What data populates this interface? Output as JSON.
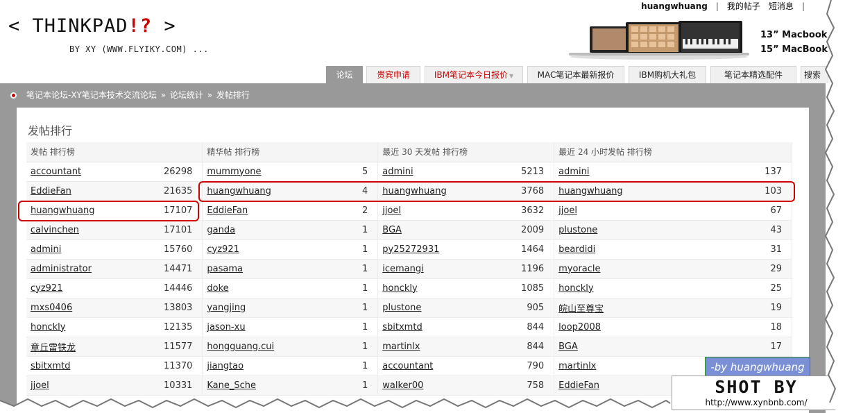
{
  "header": {
    "logo_line1": "< THINKPAD",
    "logo_bang": "!?",
    "logo_close": " >",
    "logo_line2": "BY XY (WWW.FLYIKY.COM) ..."
  },
  "toplinks": {
    "user": "huangwhuang",
    "my_posts": "我的帖子",
    "messages": "短消息"
  },
  "promo": {
    "line1": "13” Macbook",
    "line2": "15” MacBook"
  },
  "nav": {
    "tabs": [
      {
        "label": "论坛"
      },
      {
        "label": "贵宾申请"
      },
      {
        "label": "IBM笔记本今日报价"
      },
      {
        "label": "MAC笔记本最新报价"
      },
      {
        "label": "IBM购机大礼包"
      },
      {
        "label": "笔记本精选配件"
      },
      {
        "label": "搜索"
      }
    ]
  },
  "breadcrumb": {
    "items": [
      "笔记本论坛-XY笔记本技术交流论坛",
      "»",
      "论坛统计",
      "»",
      "发帖排行"
    ]
  },
  "page_title": "发帖排行",
  "columns": [
    "发帖 排行榜",
    "精华帖 排行榜",
    "最近 30 天发帖 排行榜",
    "最近 24 小时发帖 排行榜"
  ],
  "rows": [
    [
      [
        "accountant",
        "26298"
      ],
      [
        "mummyone",
        "5"
      ],
      [
        "admini",
        "5213"
      ],
      [
        "admini",
        "137"
      ]
    ],
    [
      [
        "EddieFan",
        "21635"
      ],
      [
        "huangwhuang",
        "4"
      ],
      [
        "huangwhuang",
        "3768"
      ],
      [
        "huangwhuang",
        "103"
      ]
    ],
    [
      [
        "huangwhuang",
        "17107"
      ],
      [
        "EddieFan",
        "2"
      ],
      [
        "jjoel",
        "3632"
      ],
      [
        "jjoel",
        "67"
      ]
    ],
    [
      [
        "calvinchen",
        "17101"
      ],
      [
        "ganda",
        "1"
      ],
      [
        "BGA",
        "2009"
      ],
      [
        "plustone",
        "43"
      ]
    ],
    [
      [
        "admini",
        "15760"
      ],
      [
        "cyz921",
        "1"
      ],
      [
        "py25272931",
        "1464"
      ],
      [
        "beardidi",
        "31"
      ]
    ],
    [
      [
        "administrator",
        "14471"
      ],
      [
        "pasama",
        "1"
      ],
      [
        "icemangi",
        "1196"
      ],
      [
        "myoracle",
        "29"
      ]
    ],
    [
      [
        "cyz921",
        "14446"
      ],
      [
        "doke",
        "1"
      ],
      [
        "honckly",
        "1085"
      ],
      [
        "honckly",
        "25"
      ]
    ],
    [
      [
        "mxs0406",
        "13803"
      ],
      [
        "yangjing",
        "1"
      ],
      [
        "plustone",
        "905"
      ],
      [
        "皖山至尊宝",
        "19"
      ]
    ],
    [
      [
        "honckly",
        "12135"
      ],
      [
        "jason-xu",
        "1"
      ],
      [
        "sbitxmtd",
        "844"
      ],
      [
        "loop2008",
        "18"
      ]
    ],
    [
      [
        "章丘雷铁龙",
        "11577"
      ],
      [
        "hongguang.cui",
        "1"
      ],
      [
        "martinlx",
        "844"
      ],
      [
        "BGA",
        "17"
      ]
    ],
    [
      [
        "sbitxmtd",
        "11370"
      ],
      [
        "jiangtao",
        "1"
      ],
      [
        "accountant",
        "790"
      ],
      [
        "martinlx",
        ""
      ]
    ],
    [
      [
        "jjoel",
        "10331"
      ],
      [
        "Kane_Sche",
        "1"
      ],
      [
        "walker00",
        "758"
      ],
      [
        "EddieFan",
        ""
      ]
    ]
  ],
  "stamp": {
    "by_user": "-by huangwhuang",
    "shot_by": "SHOT BY",
    "url": "http://www.xynbnb.com/"
  },
  "colors": {
    "accent_red": "#cc0000",
    "bar_gray": "#999999"
  }
}
